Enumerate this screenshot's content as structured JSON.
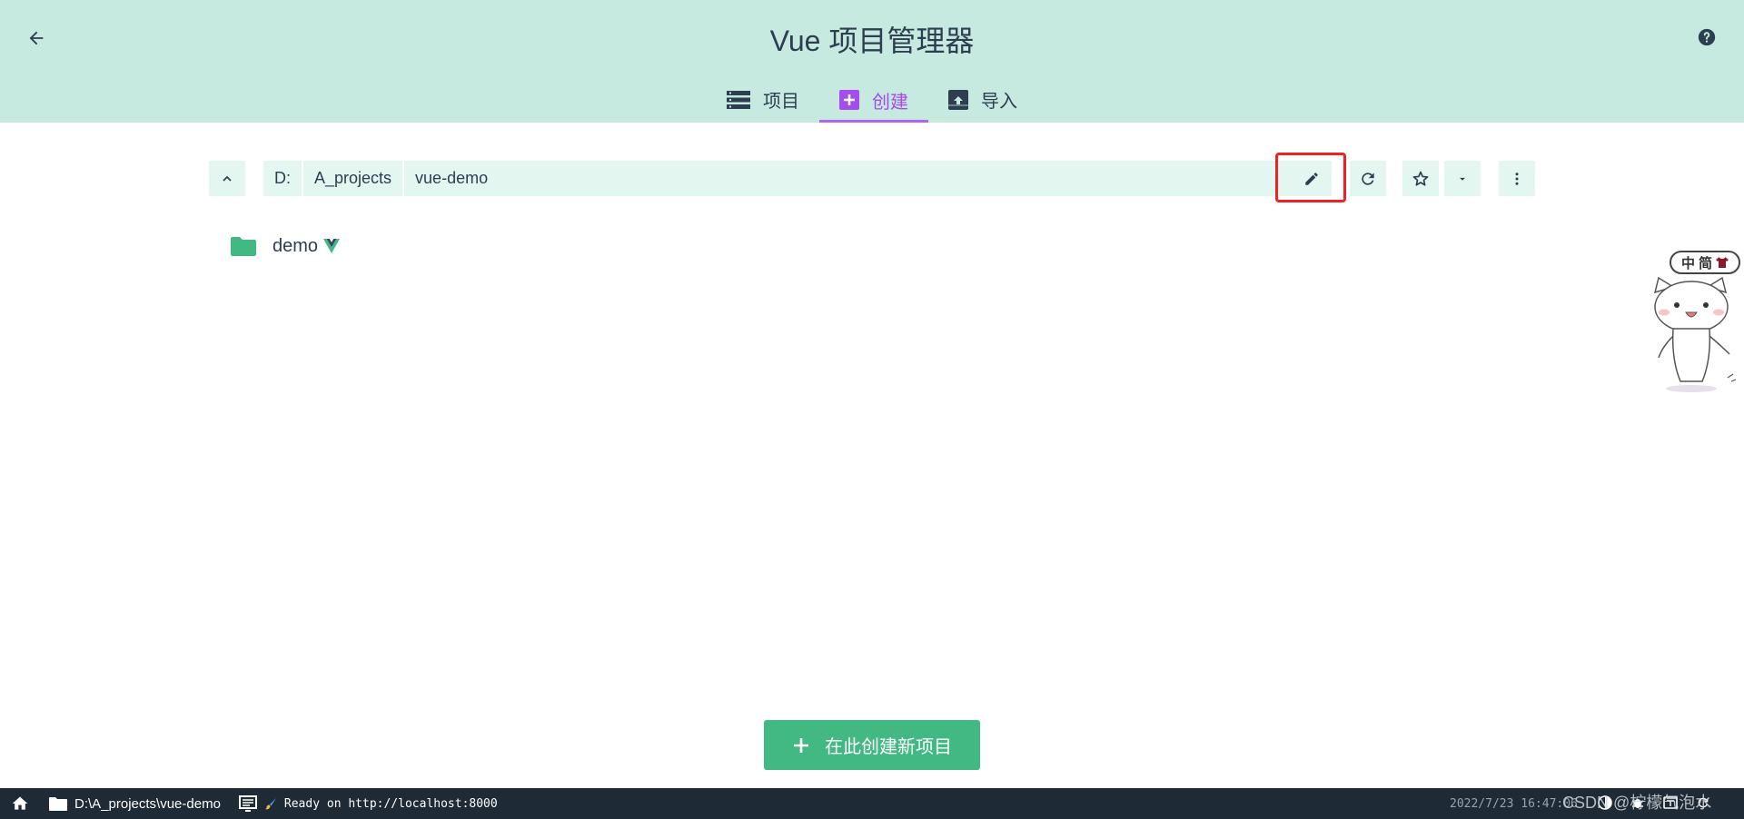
{
  "header": {
    "title": "Vue 项目管理器",
    "tabs": [
      {
        "label": "项目",
        "icon": "list-icon"
      },
      {
        "label": "创建",
        "icon": "add-box-icon"
      },
      {
        "label": "导入",
        "icon": "unarchive-icon"
      }
    ],
    "active_tab": "创建"
  },
  "path_bar": {
    "segments": [
      "D:",
      "A_projects",
      "vue-demo"
    ]
  },
  "folders": [
    {
      "name": "demo",
      "is_vue_project": true
    }
  ],
  "mascot": {
    "bubble_chars": [
      "中",
      "简"
    ]
  },
  "create_button": {
    "label": "在此创建新项目"
  },
  "status_bar": {
    "cwd": "D:\\A_projects\\vue-demo",
    "log": "Ready on http://localhost:8000",
    "timestamp": "2022/7/23 16:47:06"
  },
  "watermark": "CSDN @柠檬气泡水",
  "colors": {
    "header_bg": "#c6eadf",
    "accent_purple": "#a44cf0",
    "vue_green": "#42b883",
    "status_bar_bg": "#1e2a36",
    "highlight_red": "#ee2222"
  }
}
